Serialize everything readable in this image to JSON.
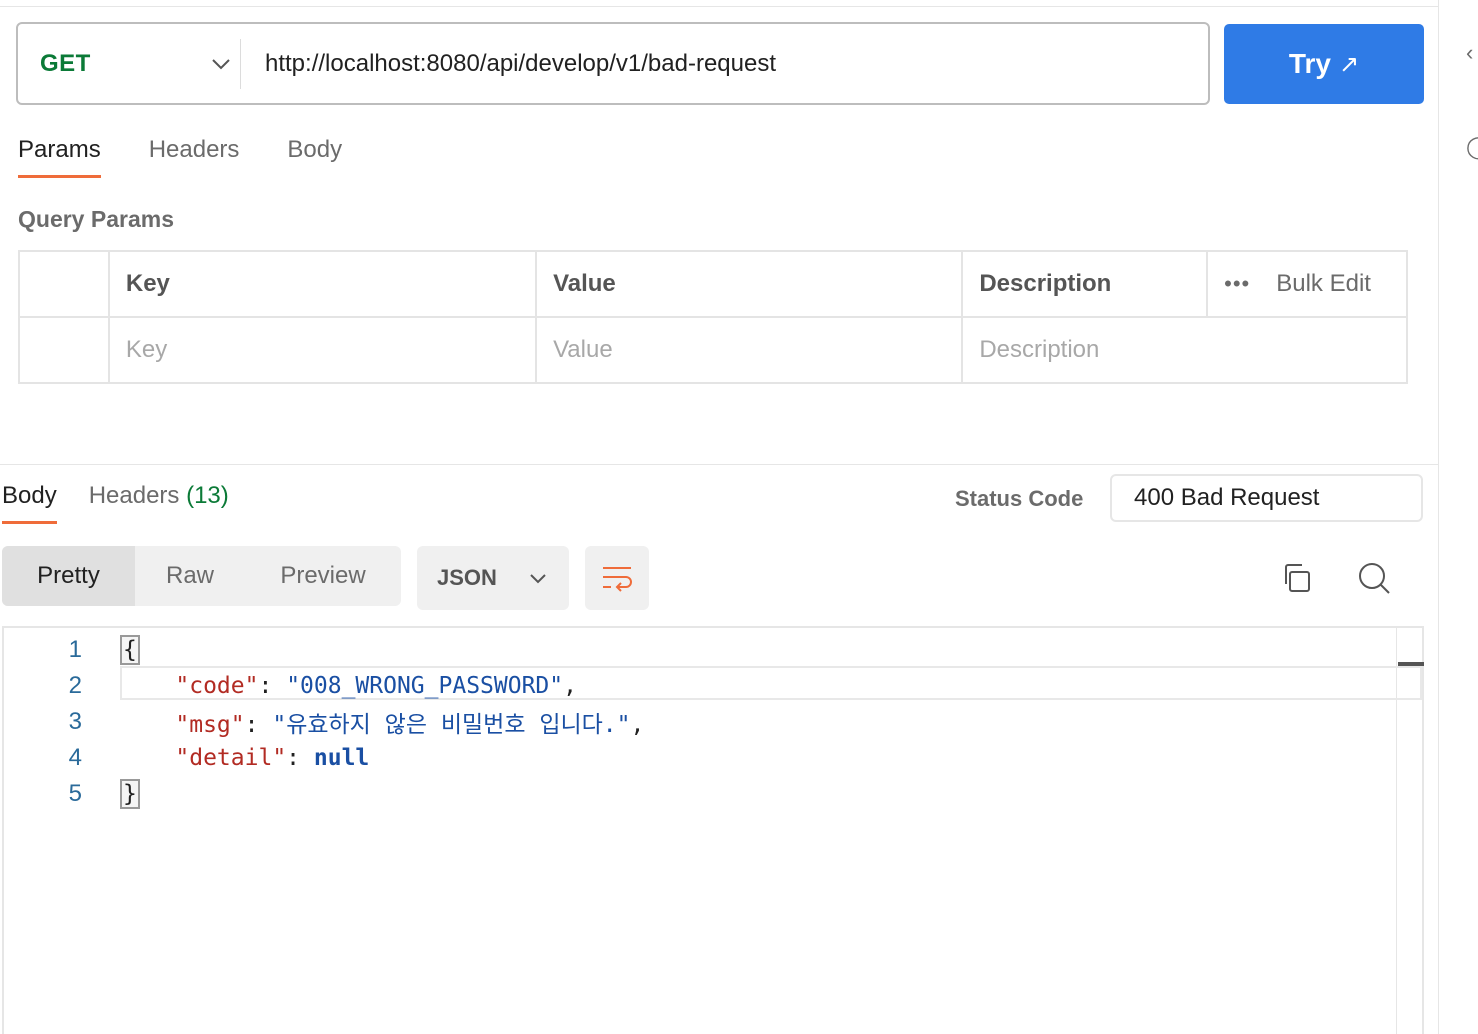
{
  "request": {
    "method": "GET",
    "url": "http://localhost:8080/api/develop/v1/bad-request",
    "try_label": "Try",
    "try_arrow": "↗"
  },
  "request_tabs": [
    "Params",
    "Headers",
    "Body"
  ],
  "query_params": {
    "title": "Query Params",
    "columns": [
      "Key",
      "Value",
      "Description"
    ],
    "bulk_edit": "Bulk Edit",
    "placeholders": {
      "key": "Key",
      "value": "Value",
      "description": "Description"
    }
  },
  "response": {
    "tabs": {
      "body": "Body",
      "headers": "Headers",
      "headers_count": "(13)"
    },
    "status_label": "Status Code",
    "status_value": "400 Bad Request",
    "views": [
      "Pretty",
      "Raw",
      "Preview"
    ],
    "format": "JSON",
    "code_lines": [
      "1",
      "2",
      "3",
      "4",
      "5"
    ],
    "json": {
      "open": "{",
      "close": "}",
      "code_key": "\"code\"",
      "code_value": "\"008_WRONG_PASSWORD\"",
      "msg_key": "\"msg\"",
      "msg_value": "\"유효하지 않은 비밀번호 입니다.\"",
      "detail_key": "\"detail\"",
      "detail_value": "null"
    }
  },
  "colors": {
    "accent": "#ef6c3a",
    "primary": "#2f7be6",
    "method_get": "#0b7a37"
  }
}
